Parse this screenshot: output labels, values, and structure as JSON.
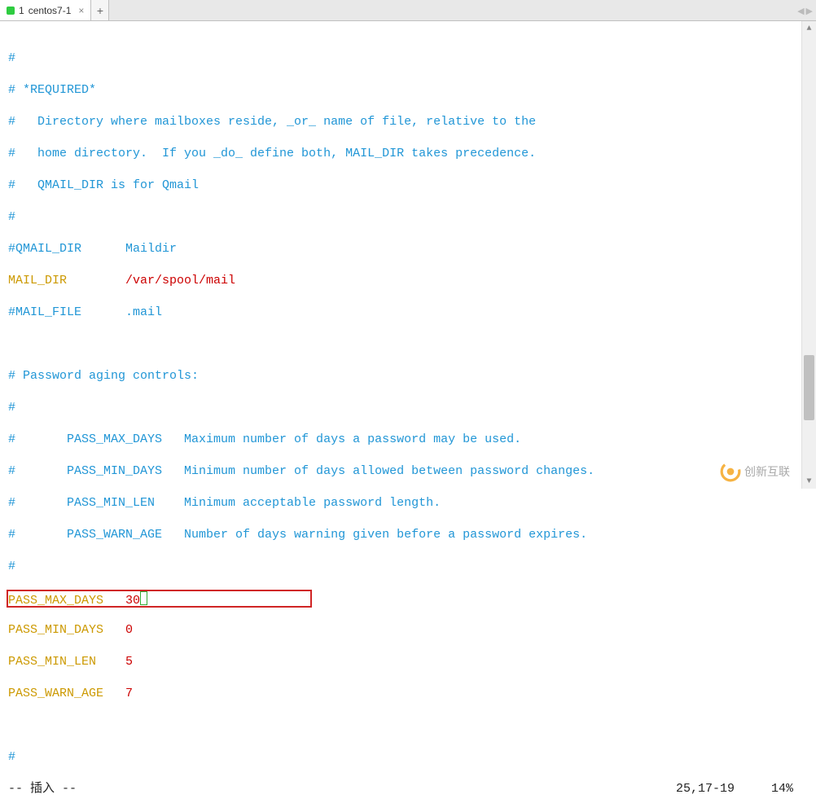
{
  "tab": {
    "index": "1",
    "label": "centos7-1",
    "close": "×"
  },
  "tab_add": "+",
  "nav": {
    "prev": "◀",
    "next": "▶"
  },
  "lines": {
    "c1": "#",
    "c2": "# *REQUIRED*",
    "c3": "#   Directory where mailboxes reside, _or_ name of file, relative to the",
    "c4": "#   home directory.  If you _do_ define both, MAIL_DIR takes precedence.",
    "c5": "#   QMAIL_DIR is for Qmail",
    "c6": "#",
    "c7": "#QMAIL_DIR      Maildir",
    "mail_dir_key": "MAIL_DIR",
    "mail_dir_gap": "        ",
    "mail_dir_val": "/var/spool/mail",
    "c8": "#MAIL_FILE      .mail",
    "blank": "",
    "c9": "# Password aging controls:",
    "c10": "#",
    "c11": "#       PASS_MAX_DAYS   Maximum number of days a password may be used.",
    "c12": "#       PASS_MIN_DAYS   Minimum number of days allowed between password changes.",
    "c13": "#       PASS_MIN_LEN    Minimum acceptable password length.",
    "c14": "#       PASS_WARN_AGE   Number of days warning given before a password expires.",
    "c15": "#",
    "pmax_k": "PASS_MAX_DAYS",
    "pmax_g": "   ",
    "pmax_v": "30",
    "pmin_k": "PASS_MIN_DAYS",
    "pmin_g": "   ",
    "pmin_v": "0",
    "plen_k": "PASS_MIN_LEN",
    "plen_g": "    ",
    "plen_v": "5",
    "pwarn_k": "PASS_WARN_AGE",
    "pwarn_g": "   ",
    "pwarn_v": "7",
    "c16": "#"
  },
  "status": {
    "mode": "-- 插入 --",
    "pos": "25,17-19     14%"
  },
  "watermark": "创新互联",
  "scroll": {
    "up": "▲",
    "down": "▼"
  }
}
